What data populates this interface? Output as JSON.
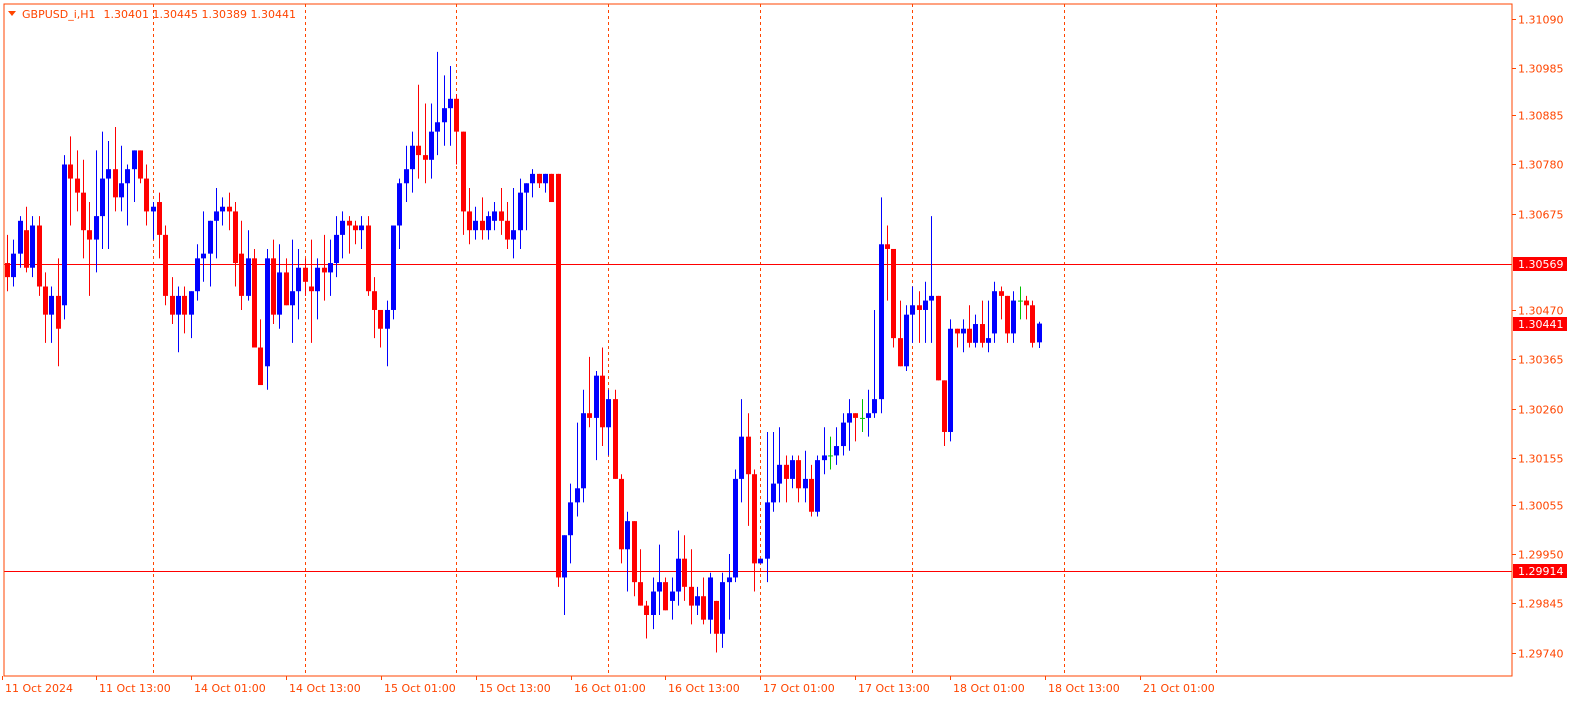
{
  "header": {
    "symbol": "GBPUSD_i,H1",
    "quote": "1.30401 1.30445 1.30389 1.30441",
    "menu_icon": "triangle-down-icon"
  },
  "colors": {
    "background": "#ffffff",
    "frame": "#ff4500",
    "text": "#ff4500",
    "grid": "#ff4500",
    "bull": "#0000ff",
    "bear": "#ff0000",
    "doji": "#00c000",
    "hline": "#ff0000",
    "label_bg": "#ff0000",
    "label_text": "#ffffff"
  },
  "chart_data": {
    "type": "candlestick",
    "timeframe": "H1",
    "y_range": [
      1.2969,
      1.31122
    ],
    "y_ticks": [
      "1.31090",
      "1.30985",
      "1.30885",
      "1.30780",
      "1.30675",
      "1.30470",
      "1.30365",
      "1.30260",
      "1.30155",
      "1.30055",
      "1.29950",
      "1.29845",
      "1.29740"
    ],
    "x_labels": [
      "11 Oct 2024",
      "11 Oct 13:00",
      "14 Oct 01:00",
      "14 Oct 13:00",
      "15 Oct 01:00",
      "15 Oct 13:00",
      "16 Oct 01:00",
      "16 Oct 13:00",
      "17 Oct 01:00",
      "17 Oct 13:00",
      "18 Oct 01:00",
      "18 Oct 13:00",
      "21 Oct 01:00"
    ],
    "separator_indices": [
      23,
      47,
      71,
      95,
      119,
      143,
      167
    ],
    "horizontal_lines": [
      {
        "price": 1.30569,
        "label": "1.30569"
      },
      {
        "price": 1.29914,
        "label": "1.29914"
      }
    ],
    "current_price": {
      "price": 1.30441,
      "label": "1.30441"
    },
    "candles": [
      [
        1.3057,
        1.3063,
        1.3051,
        1.3054
      ],
      [
        1.3054,
        1.3062,
        1.3052,
        1.3059
      ],
      [
        1.3059,
        1.3067,
        1.3056,
        1.3066
      ],
      [
        1.3064,
        1.3069,
        1.3055,
        1.3056
      ],
      [
        1.3056,
        1.3067,
        1.3054,
        1.3065
      ],
      [
        1.3065,
        1.3067,
        1.305,
        1.3052
      ],
      [
        1.3052,
        1.3055,
        1.304,
        1.3046
      ],
      [
        1.3046,
        1.3052,
        1.304,
        1.305
      ],
      [
        1.305,
        1.3058,
        1.3035,
        1.3043
      ],
      [
        1.3048,
        1.308,
        1.3045,
        1.3078
      ],
      [
        1.3078,
        1.3084,
        1.3065,
        1.3075
      ],
      [
        1.3075,
        1.3081,
        1.3068,
        1.3072
      ],
      [
        1.3072,
        1.3079,
        1.3058,
        1.3064
      ],
      [
        1.3064,
        1.307,
        1.305,
        1.3062
      ],
      [
        1.3062,
        1.3081,
        1.3055,
        1.3067
      ],
      [
        1.3067,
        1.3085,
        1.306,
        1.3075
      ],
      [
        1.3075,
        1.3083,
        1.306,
        1.3077
      ],
      [
        1.3077,
        1.3086,
        1.3068,
        1.3071
      ],
      [
        1.3071,
        1.3082,
        1.3068,
        1.3074
      ],
      [
        1.3074,
        1.3078,
        1.3065,
        1.3077
      ],
      [
        1.3077,
        1.308,
        1.307,
        1.3081
      ],
      [
        1.3081,
        1.3079,
        1.3074,
        1.3075
      ],
      [
        1.3075,
        1.3078,
        1.3065,
        1.3068
      ],
      [
        1.3068,
        1.307,
        1.3062,
        1.3069
      ],
      [
        1.307,
        1.3072,
        1.3058,
        1.3063
      ],
      [
        1.3063,
        1.3065,
        1.3048,
        1.305
      ],
      [
        1.305,
        1.3054,
        1.3044,
        1.3046
      ],
      [
        1.3046,
        1.3052,
        1.3038,
        1.305
      ],
      [
        1.305,
        1.3052,
        1.3042,
        1.3046
      ],
      [
        1.3046,
        1.305,
        1.3041,
        1.3051
      ],
      [
        1.3051,
        1.3061,
        1.3049,
        1.3058
      ],
      [
        1.3058,
        1.3068,
        1.3053,
        1.3059
      ],
      [
        1.3059,
        1.3065,
        1.3052,
        1.3066
      ],
      [
        1.3066,
        1.3073,
        1.3058,
        1.3068
      ],
      [
        1.3068,
        1.3071,
        1.3065,
        1.3069
      ],
      [
        1.3069,
        1.3072,
        1.3064,
        1.3068
      ],
      [
        1.3068,
        1.307,
        1.3052,
        1.3057
      ],
      [
        1.3059,
        1.3066,
        1.3047,
        1.305
      ],
      [
        1.305,
        1.3064,
        1.3049,
        1.3058
      ],
      [
        1.3058,
        1.306,
        1.304,
        1.3039
      ],
      [
        1.3039,
        1.3045,
        1.3031,
        1.3031
      ],
      [
        1.3035,
        1.306,
        1.303,
        1.3058
      ],
      [
        1.3058,
        1.3062,
        1.3044,
        1.3046
      ],
      [
        1.3046,
        1.3061,
        1.3043,
        1.3055
      ],
      [
        1.3055,
        1.3058,
        1.3048,
        1.3048
      ],
      [
        1.3048,
        1.3062,
        1.304,
        1.3051
      ],
      [
        1.3051,
        1.306,
        1.3045,
        1.3056
      ],
      [
        1.3056,
        1.3058,
        1.305,
        1.3053
      ],
      [
        1.3052,
        1.3062,
        1.304,
        1.3051
      ],
      [
        1.3051,
        1.3058,
        1.3045,
        1.3056
      ],
      [
        1.3056,
        1.3063,
        1.3049,
        1.3055
      ],
      [
        1.3055,
        1.3062,
        1.305,
        1.3057
      ],
      [
        1.3057,
        1.3067,
        1.3054,
        1.3063
      ],
      [
        1.3063,
        1.3068,
        1.3058,
        1.3066
      ],
      [
        1.3066,
        1.3067,
        1.3059,
        1.3065
      ],
      [
        1.3065,
        1.3066,
        1.3061,
        1.3064
      ],
      [
        1.3064,
        1.3067,
        1.306,
        1.3065
      ],
      [
        1.3065,
        1.3067,
        1.305,
        1.3051
      ],
      [
        1.3051,
        1.3054,
        1.3041,
        1.3047
      ],
      [
        1.3047,
        1.3045,
        1.3039,
        1.3043
      ],
      [
        1.3043,
        1.3049,
        1.3035,
        1.3047
      ],
      [
        1.3047,
        1.3065,
        1.3045,
        1.3065
      ],
      [
        1.3065,
        1.3075,
        1.306,
        1.3074
      ],
      [
        1.3074,
        1.3082,
        1.307,
        1.3077
      ],
      [
        1.3077,
        1.3085,
        1.3072,
        1.3082
      ],
      [
        1.3082,
        1.3095,
        1.3075,
        1.308
      ],
      [
        1.308,
        1.3091,
        1.3074,
        1.3079
      ],
      [
        1.3079,
        1.3091,
        1.3075,
        1.3085
      ],
      [
        1.3085,
        1.3102,
        1.308,
        1.3087
      ],
      [
        1.3087,
        1.3097,
        1.3082,
        1.309
      ],
      [
        1.309,
        1.3099,
        1.3082,
        1.3092
      ],
      [
        1.3092,
        1.3093,
        1.3078,
        1.3085
      ],
      [
        1.3085,
        1.3083,
        1.3063,
        1.3068
      ],
      [
        1.3068,
        1.3073,
        1.3061,
        1.3064
      ],
      [
        1.3064,
        1.3069,
        1.3062,
        1.3066
      ],
      [
        1.3066,
        1.3071,
        1.3062,
        1.3064
      ],
      [
        1.3064,
        1.3068,
        1.3062,
        1.3067
      ],
      [
        1.3066,
        1.307,
        1.3064,
        1.3068
      ],
      [
        1.3068,
        1.3073,
        1.3063,
        1.3066
      ],
      [
        1.3066,
        1.307,
        1.306,
        1.3062
      ],
      [
        1.3062,
        1.3073,
        1.3058,
        1.3064
      ],
      [
        1.3064,
        1.3075,
        1.306,
        1.3072
      ],
      [
        1.3072,
        1.3074,
        1.3064,
        1.3074
      ],
      [
        1.3074,
        1.3077,
        1.3071,
        1.3076
      ],
      [
        1.3076,
        1.307,
        1.3073,
        1.3074
      ],
      [
        1.3074,
        1.3076,
        1.3072,
        1.3076
      ],
      [
        1.3076,
        1.3076,
        1.307,
        1.307
      ],
      [
        1.3076,
        1.3076,
        1.2988,
        1.299
      ],
      [
        1.299,
        1.2999,
        1.2982,
        1.2999
      ],
      [
        1.2999,
        1.301,
        1.2993,
        1.3006
      ],
      [
        1.3006,
        1.3023,
        1.3003,
        1.3009
      ],
      [
        1.3009,
        1.303,
        1.3006,
        1.3025
      ],
      [
        1.3025,
        1.3037,
        1.3022,
        1.3024
      ],
      [
        1.3024,
        1.3034,
        1.3015,
        1.3033
      ],
      [
        1.3033,
        1.3039,
        1.3018,
        1.3022
      ],
      [
        1.3022,
        1.303,
        1.3016,
        1.3028
      ],
      [
        1.3028,
        1.303,
        1.3013,
        1.3011
      ],
      [
        1.3011,
        1.3012,
        1.2993,
        1.2996
      ],
      [
        1.2996,
        1.3004,
        1.2987,
        1.3002
      ],
      [
        1.3002,
        1.3002,
        1.2986,
        1.2989
      ],
      [
        1.2989,
        1.2996,
        1.2985,
        1.2984
      ],
      [
        1.2984,
        1.2985,
        1.2977,
        1.2982
      ],
      [
        1.2982,
        1.299,
        1.2979,
        1.2987
      ],
      [
        1.2987,
        1.2997,
        1.2982,
        1.2989
      ],
      [
        1.2989,
        1.299,
        1.2984,
        1.2983
      ],
      [
        1.2985,
        1.299,
        1.2981,
        1.2987
      ],
      [
        1.2987,
        1.3,
        1.2984,
        1.2994
      ],
      [
        1.2994,
        1.2999,
        1.2985,
        1.2988
      ],
      [
        1.2988,
        1.2996,
        1.298,
        1.2984
      ],
      [
        1.2984,
        1.2988,
        1.2982,
        1.2986
      ],
      [
        1.2986,
        1.299,
        1.298,
        1.2981
      ],
      [
        1.2981,
        1.2991,
        1.2978,
        1.299
      ],
      [
        1.2985,
        1.2982,
        1.2974,
        1.2978
      ],
      [
        1.2978,
        1.2991,
        1.2975,
        1.2989
      ],
      [
        1.2989,
        1.2995,
        1.2981,
        1.299
      ],
      [
        1.299,
        1.3013,
        1.2989,
        1.3011
      ],
      [
        1.3011,
        1.3028,
        1.3006,
        1.302
      ],
      [
        1.302,
        1.3025,
        1.3001,
        1.3012
      ],
      [
        1.3012,
        1.3013,
        1.2987,
        1.2993
      ],
      [
        1.2993,
        1.2988,
        1.2996,
        1.2994
      ],
      [
        1.2994,
        1.3021,
        1.2989,
        1.3006
      ],
      [
        1.3006,
        1.3021,
        1.3004,
        1.301
      ],
      [
        1.301,
        1.3022,
        1.3006,
        1.3014
      ],
      [
        1.3014,
        1.3016,
        1.3006,
        1.3011
      ],
      [
        1.3011,
        1.3016,
        1.3009,
        1.3015
      ],
      [
        1.3015,
        1.3016,
        1.3006,
        1.3009
      ],
      [
        1.3009,
        1.3017,
        1.3006,
        1.3011
      ],
      [
        1.3011,
        1.3014,
        1.3003,
        1.3004
      ],
      [
        1.3004,
        1.3016,
        1.3003,
        1.3015
      ],
      [
        1.3015,
        1.3022,
        1.3012,
        1.3016
      ],
      [
        1.3016,
        1.302,
        1.3013,
        1.3016
      ],
      [
        1.3016,
        1.3022,
        1.3014,
        1.3018
      ],
      [
        1.3018,
        1.3025,
        1.3016,
        1.3023
      ],
      [
        1.3023,
        1.3028,
        1.3017,
        1.3025
      ],
      [
        1.3025,
        1.3024,
        1.3019,
        1.3024
      ],
      [
        1.3024,
        1.3028,
        1.3021,
        1.3024
      ],
      [
        1.3024,
        1.303,
        1.302,
        1.3025
      ],
      [
        1.3025,
        1.3047,
        1.3024,
        1.3028
      ],
      [
        1.3028,
        1.3071,
        1.3025,
        1.3061
      ],
      [
        1.3061,
        1.3065,
        1.3049,
        1.306
      ],
      [
        1.306,
        1.3046,
        1.3039,
        1.3041
      ],
      [
        1.3041,
        1.3049,
        1.3038,
        1.3035
      ],
      [
        1.3035,
        1.3048,
        1.3034,
        1.3046
      ],
      [
        1.3046,
        1.3052,
        1.304,
        1.3048
      ],
      [
        1.3048,
        1.3051,
        1.304,
        1.3047
      ],
      [
        1.3047,
        1.3053,
        1.304,
        1.3049
      ],
      [
        1.3049,
        1.3067,
        1.304,
        1.305
      ],
      [
        1.305,
        1.305,
        1.304,
        1.3032
      ],
      [
        1.3032,
        1.3032,
        1.3018,
        1.3021
      ],
      [
        1.3021,
        1.3045,
        1.3019,
        1.3043
      ],
      [
        1.3043,
        1.3043,
        1.3039,
        1.3042
      ],
      [
        1.3042,
        1.3045,
        1.3038,
        1.3043
      ],
      [
        1.3043,
        1.3048,
        1.3039,
        1.304
      ],
      [
        1.304,
        1.3046,
        1.3039,
        1.3044
      ],
      [
        1.3044,
        1.3049,
        1.3039,
        1.304
      ],
      [
        1.304,
        1.3049,
        1.3038,
        1.3041
      ],
      [
        1.3042,
        1.3053,
        1.304,
        1.3051
      ],
      [
        1.3051,
        1.3052,
        1.3045,
        1.305
      ],
      [
        1.305,
        1.305,
        1.304,
        1.3042
      ],
      [
        1.3042,
        1.3051,
        1.304,
        1.3049
      ],
      [
        1.3049,
        1.3052,
        1.3045,
        1.3049
      ],
      [
        1.3049,
        1.305,
        1.3045,
        1.3048
      ],
      [
        1.3048,
        1.3049,
        1.3039,
        1.304
      ],
      [
        1.30401,
        1.30445,
        1.30389,
        1.30441
      ]
    ]
  }
}
